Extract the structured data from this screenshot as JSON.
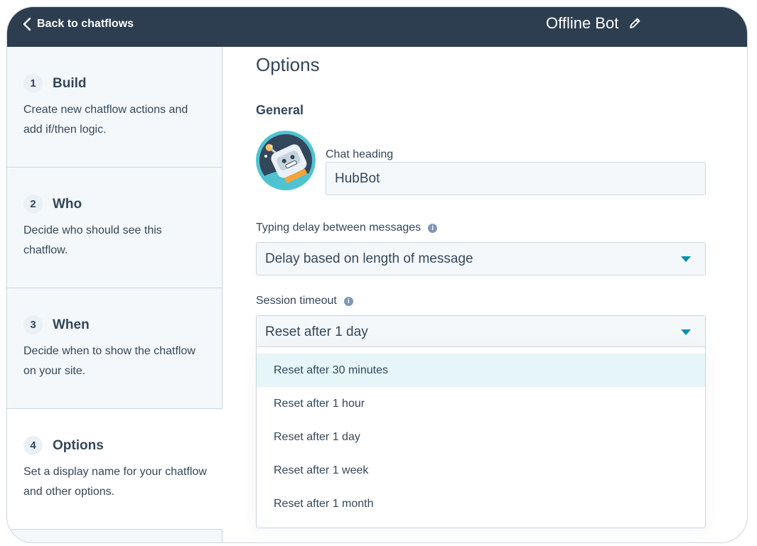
{
  "header": {
    "back_label": "Back to chatflows",
    "bot_name": "Offline Bot"
  },
  "sidebar": {
    "steps": [
      {
        "number": "1",
        "title": "Build",
        "description": "Create new chatflow actions and add if/then logic."
      },
      {
        "number": "2",
        "title": "Who",
        "description": "Decide who should see this chatflow."
      },
      {
        "number": "3",
        "title": "When",
        "description": "Decide when to show the chatflow on your site."
      },
      {
        "number": "4",
        "title": "Options",
        "description": "Set a display name for your chatflow and other options."
      }
    ],
    "active_step": 4
  },
  "main": {
    "title": "Options",
    "section": "General",
    "chat_heading": {
      "label": "Chat heading",
      "value": "HubBot"
    },
    "typing_delay": {
      "label": "Typing delay between messages",
      "value": "Delay based on length of message"
    },
    "session_timeout": {
      "label": "Session timeout",
      "value": "Reset after 1 day",
      "options": [
        "Reset after 30 minutes",
        "Reset after 1 hour",
        "Reset after 1 day",
        "Reset after 1 week",
        "Reset after 1 month"
      ],
      "highlighted_option": "Reset after 30 minutes"
    }
  },
  "icons": {
    "back": "chevron-left-icon",
    "edit": "pencil-icon",
    "info": "info-icon",
    "dropdown": "caret-down-icon",
    "avatar": "robot-avatar"
  },
  "colors": {
    "header_bg": "#2d3e50",
    "sidebar_bg": "#f5f8fa",
    "text": "#33475b",
    "accent": "#0091ae",
    "highlight": "#e5f5f8",
    "border": "#cbd6e2"
  }
}
